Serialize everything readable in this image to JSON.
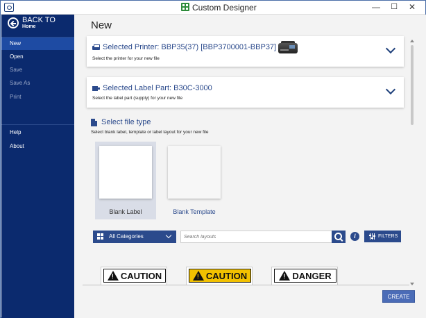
{
  "window": {
    "title": "Custom Designer",
    "minimize": "—",
    "maximize": "☐",
    "close": "✕"
  },
  "sidebar": {
    "back_title": "BACK TO",
    "back_sub": "Home",
    "items": [
      {
        "label": "New",
        "state": "active"
      },
      {
        "label": "Open",
        "state": "enabled"
      },
      {
        "label": "Save",
        "state": "disabled"
      },
      {
        "label": "Save As",
        "state": "disabled"
      },
      {
        "label": "Print",
        "state": "disabled"
      }
    ],
    "lower_items": [
      {
        "label": "Help"
      },
      {
        "label": "About"
      }
    ]
  },
  "main": {
    "page_title": "New",
    "printer": {
      "label": "Selected Printer:",
      "value": "BBP35(37) [BBP3700001-BBP37]",
      "sub": "Select the printer for your new file"
    },
    "label_part": {
      "label": "Selected Label Part:",
      "value": "B30C-3000",
      "sub": "Select the label part (supply) for your new file"
    },
    "file_type": {
      "title": "Select file type",
      "sub": "Select blank label, template or label layout for your new file",
      "options": [
        {
          "label": "Blank Label",
          "selected": true
        },
        {
          "label": "Blank Template",
          "selected": false
        }
      ]
    },
    "search": {
      "category": "All Categories",
      "placeholder": "Search layouts",
      "info": "i",
      "filters": "FILTERS"
    },
    "layouts": [
      {
        "text": "CAUTION",
        "style": "white"
      },
      {
        "text": "CAUTION",
        "style": "yellow"
      },
      {
        "text": "DANGER",
        "style": "white"
      }
    ],
    "create": "CREATE"
  },
  "colors": {
    "sidebar_bg": "#0b2a6e",
    "sidebar_active": "#1e4ba3",
    "accent": "#2b4a8c",
    "caution_yellow": "#f2c100",
    "create_button": "#4b6cb7"
  }
}
